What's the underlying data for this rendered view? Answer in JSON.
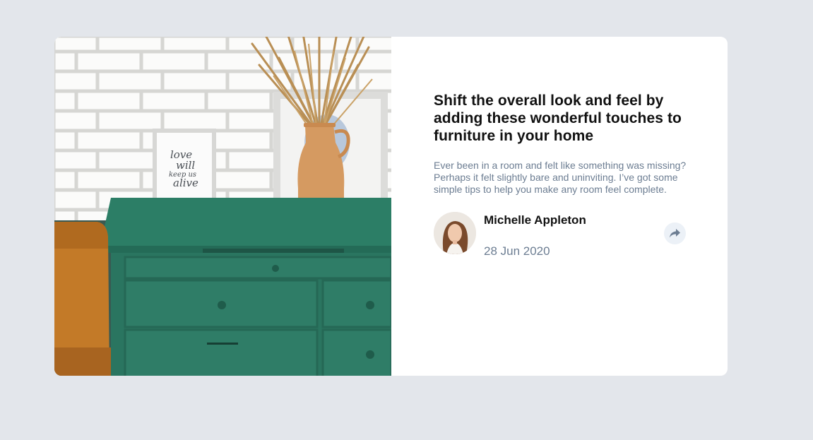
{
  "article": {
    "image_alt": "Green drawers",
    "title": "Shift the overall look and feel by adding these wonderful touches to furniture in your home",
    "description": "Ever been in a room and felt like something was missing? Perhaps it felt slightly bare and uninviting. I’ve got some simple tips to help you make any room feel complete.",
    "frame_text": [
      "love",
      "will",
      "keep us",
      "alive"
    ]
  },
  "author": {
    "name": "Michelle Appleton",
    "date": "28 Jun 2020",
    "share_icon": "share-icon"
  },
  "colors": {
    "page_bg": "#e3e6eb",
    "card_bg": "#ffffff",
    "title": "#111111",
    "text_muted": "#6c7d92",
    "share_bg": "#ecf1f7",
    "share_icon": "#6c7d92",
    "dresser": "#2f7a63"
  }
}
